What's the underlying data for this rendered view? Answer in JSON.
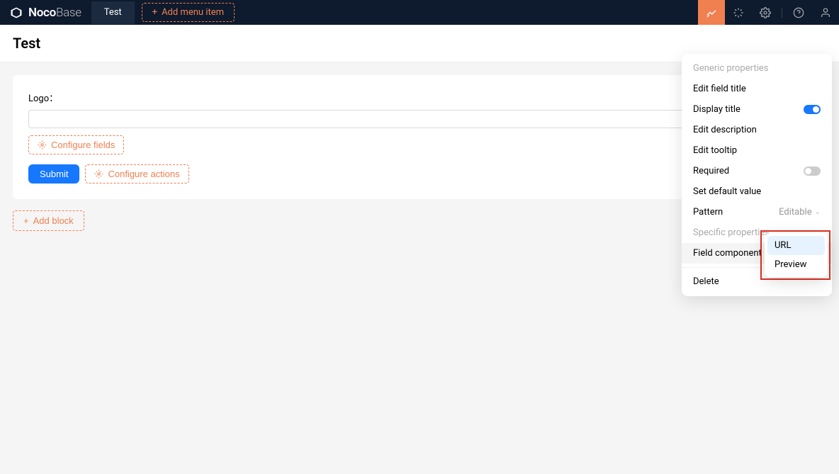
{
  "header": {
    "logo_bold": "Noco",
    "logo_light": "Base",
    "tab": "Test",
    "add_menu": "Add menu item"
  },
  "page": {
    "title": "Test"
  },
  "form": {
    "field_label": "Logo：",
    "configure_fields": "Configure fields",
    "submit": "Submit",
    "configure_actions": "Configure actions"
  },
  "add_block": "Add block",
  "popover": {
    "section1": "Generic properties",
    "items": {
      "edit_title": "Edit field title",
      "display_title": "Display title",
      "edit_desc": "Edit description",
      "edit_tooltip": "Edit tooltip",
      "required": "Required",
      "set_default": "Set default value",
      "pattern": "Pattern",
      "pattern_val": "Editable"
    },
    "section2": "Specific properties",
    "field_component": "Field component",
    "field_component_val": "URL",
    "delete": "Delete"
  },
  "dropdown": {
    "url": "URL",
    "preview": "Preview"
  }
}
